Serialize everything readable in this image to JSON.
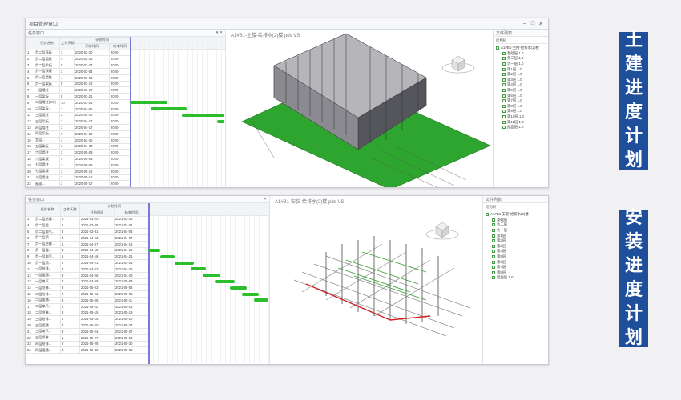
{
  "top": {
    "window_title": "项目管理窗口",
    "left_panel_title": "任务窗口",
    "col_headers": [
      "",
      "任务名称",
      "工作天数"
    ],
    "group_header": "计划时间",
    "sub_headers": [
      "开始时间",
      "结束时间"
    ],
    "rows": [
      [
        "1",
        "负二层筏板",
        "3",
        "2020-02-20",
        "2020-"
      ],
      [
        "2",
        "负二层墙柱",
        "4",
        "2020-02-23",
        "2020-"
      ],
      [
        "3",
        "负二层梁板",
        "5",
        "2020-02-27",
        "2020-"
      ],
      [
        "4",
        "负一层筏板",
        "3",
        "2020-03-04",
        "2020-"
      ],
      [
        "5",
        "负一层墙柱",
        "4",
        "2020-03-08",
        "2020-"
      ],
      [
        "6",
        "负一层梁板",
        "5",
        "2020-03-12",
        "2020-"
      ],
      [
        "7",
        "一层墙柱",
        "4",
        "2020-03-17",
        "2020-"
      ],
      [
        "8",
        "一层梁板",
        "5",
        "2020-03-21",
        "2020-"
      ],
      [
        "9",
        "二层墙柱(CO)",
        "10",
        "2020-03-26",
        "2020-"
      ],
      [
        "10",
        "二层梁板...",
        "7",
        "2020-04-05",
        "2020-"
      ],
      [
        "11",
        "三层墙柱",
        "2",
        "2020-04-12",
        "2020-"
      ],
      [
        "12",
        "三层梁板",
        "3",
        "2020-04-14",
        "2020-"
      ],
      [
        "13",
        "四层墙柱",
        "3",
        "2020-04-17",
        "2020-"
      ],
      [
        "14",
        "四层梁板",
        "6",
        "2020-04-20",
        "2020-"
      ],
      [
        "15",
        "五层...",
        "4",
        "2020-04-26",
        "2020-"
      ],
      [
        "16",
        "五层梁板",
        "3",
        "2020-04-30",
        "2020-"
      ],
      [
        "17",
        "六层墙柱",
        "2",
        "2020-05-03",
        "2020-"
      ],
      [
        "18",
        "六层梁板",
        "4",
        "2020-05-05",
        "2020-"
      ],
      [
        "19",
        "七层墙柱",
        "3",
        "2020-05-09",
        "2020-"
      ],
      [
        "20",
        "七层梁板",
        "3",
        "2020-05-12",
        "2020-"
      ],
      [
        "21",
        "八层墙柱",
        "2",
        "2020-05-15",
        "2020-"
      ],
      [
        "22",
        "屋面...",
        "3",
        "2020-05-17",
        "2020-"
      ]
    ],
    "gantt_bars": [
      {
        "row": 8,
        "start": 0.0,
        "end": 0.4
      },
      {
        "row": 9,
        "start": 0.22,
        "end": 0.6
      },
      {
        "row": 10,
        "start": 0.55,
        "end": 1.0
      },
      {
        "row": 11,
        "start": 0.92,
        "end": 1.0
      }
    ],
    "viewer_title": "A1#B1-主楼-给排水(2)楼 pds VS",
    "tree_title": "文件列表",
    "tree_tab": "结构树",
    "tree_items": [
      "A1#B1-主楼-给排水(2)楼",
      "基础层 1.0",
      "负二层 1.0",
      "负一层 1.0",
      "第1层 1.0",
      "第2层 1.0",
      "第3层 1.0",
      "第4层 1.0",
      "第5层 1.0",
      "第6层 1.0",
      "第7层 1.0",
      "第8层 1.0",
      "第9层 1.0",
      "第10层 1.0",
      "第11层 1.0",
      "屋面层 1.0"
    ]
  },
  "bottom": {
    "left_panel_title": "任务窗口",
    "col_headers": [
      "",
      "任务名称",
      "工作天数"
    ],
    "group_header": "计划时间",
    "sub_headers": [
      "开始时间",
      "结束时间"
    ],
    "rows": [
      [
        "3",
        "负二层给排...",
        "5",
        "2021-03-20",
        "2021-03-25"
      ],
      [
        "4",
        "负二层暖...",
        "6",
        "2021-03-25",
        "2021-03-31"
      ],
      [
        "5",
        "负二层电气...",
        "3",
        "2021-03-31",
        "2021-04-03"
      ],
      [
        "6",
        "负二层喷...",
        "4",
        "2021-04-03",
        "2021-04-07"
      ],
      [
        "7",
        "负一层给排...",
        "5",
        "2021-04-07",
        "2021-04-12"
      ],
      [
        "8",
        "负一层暖...",
        "4",
        "2021-04-12",
        "2021-04-16"
      ],
      [
        "9",
        "负一层电气...",
        "5",
        "2021-04-16",
        "2021-04-21"
      ],
      [
        "10",
        "负一层喷...",
        "2",
        "2021-04-21",
        "2021-04-23"
      ],
      [
        "11",
        "一层给排...",
        "3",
        "2021-04-23",
        "2021-04-26"
      ],
      [
        "12",
        "一层暖通...",
        "3",
        "2021-04-26",
        "2021-04-29"
      ],
      [
        "13",
        "一层电气...",
        "4",
        "2021-04-29",
        "2021-05-03"
      ],
      [
        "14",
        "一层喷淋...",
        "3",
        "2021-05-03",
        "2021-05-06"
      ],
      [
        "15",
        "二层给排...",
        "2",
        "2021-05-06",
        "2021-05-08"
      ],
      [
        "16",
        "二层暖通...",
        "3",
        "2021-05-08",
        "2021-05-11"
      ],
      [
        "17",
        "二层电气...",
        "4",
        "2021-05-11",
        "2021-05-15"
      ],
      [
        "18",
        "二层喷淋...",
        "3",
        "2021-05-15",
        "2021-05-18"
      ],
      [
        "19",
        "三层给排...",
        "2",
        "2021-05-18",
        "2021-05-20"
      ],
      [
        "20",
        "三层暖通...",
        "4",
        "2021-05-20",
        "2021-05-24"
      ],
      [
        "21",
        "三层电气...",
        "3",
        "2021-05-24",
        "2021-05-27"
      ],
      [
        "22",
        "三层喷淋...",
        "1",
        "2021-05-27",
        "2021-05-28"
      ],
      [
        "23",
        "四层给排...",
        "2",
        "2021-05-28",
        "2021-05-30"
      ],
      [
        "24",
        "四层暖通...",
        "3",
        "2021-05-30",
        "2021-06-02"
      ]
    ],
    "gantt_bars": [
      {
        "row": 5,
        "start": 0.0,
        "end": 0.1
      },
      {
        "row": 6,
        "start": 0.1,
        "end": 0.22
      },
      {
        "row": 7,
        "start": 0.22,
        "end": 0.38
      },
      {
        "row": 8,
        "start": 0.35,
        "end": 0.48
      },
      {
        "row": 9,
        "start": 0.45,
        "end": 0.6
      },
      {
        "row": 10,
        "start": 0.55,
        "end": 0.72
      },
      {
        "row": 11,
        "start": 0.68,
        "end": 0.82
      },
      {
        "row": 12,
        "start": 0.78,
        "end": 0.92
      },
      {
        "row": 13,
        "start": 0.88,
        "end": 1.0
      }
    ],
    "viewer_title": "A1#B1-安装-给排水(2)楼 pds VS",
    "tree_title": "文件列表",
    "tree_tab": "结构树",
    "tree_items": [
      "A1#B1-安装-给排水(2)楼",
      "基础层",
      "负二层",
      "负一层",
      "第1层",
      "第2层",
      "第3层",
      "第4层",
      "第5层",
      "第6层",
      "第7层",
      "第8层",
      "屋面层 1.0"
    ]
  },
  "side_labels": {
    "civil": "土建进度计划",
    "install": "安装进度计划"
  },
  "colors": {
    "accent": "#1f4e9b",
    "bar": "#2bbf2b",
    "ground": "#2ea52e"
  }
}
